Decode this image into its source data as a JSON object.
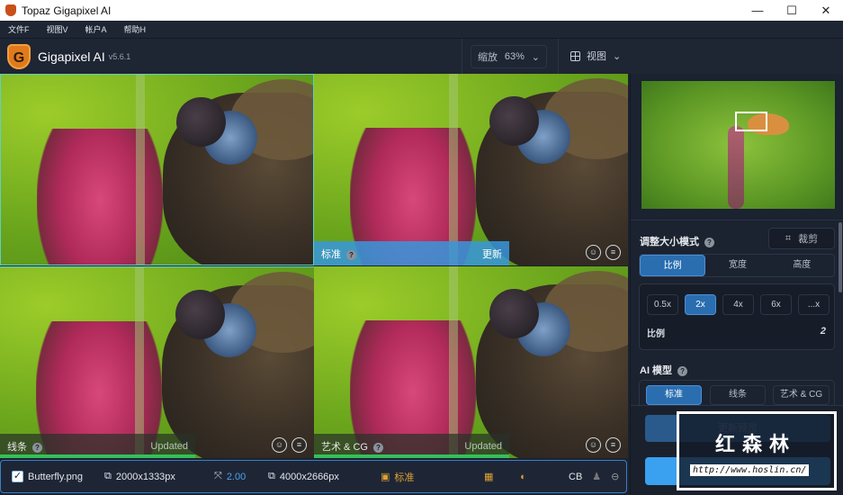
{
  "window": {
    "title": "Topaz Gigapixel AI",
    "min": "—",
    "max": "☐",
    "close": "✕"
  },
  "menu": [
    {
      "label": "文件F"
    },
    {
      "label": "视图V"
    },
    {
      "label": "帐户A"
    },
    {
      "label": "帮助H"
    }
  ],
  "header": {
    "app_name": "Gigapixel AI",
    "version": "v5.6.1",
    "zoom_label": "缩放",
    "zoom_value": "63%",
    "view_label": "视图",
    "logo_letter": "G"
  },
  "panes": [
    {
      "label": "",
      "status": ""
    },
    {
      "label": "标准",
      "status": "更新"
    },
    {
      "label": "线条",
      "status": "Updated"
    },
    {
      "label": "艺术 & CG",
      "status": "Updated"
    }
  ],
  "statusbar": {
    "filename": "Butterfly.png",
    "input_size": "2000x1333px",
    "scale": "2.00",
    "output_size": "4000x2666px",
    "model": "标准",
    "cb": "CB"
  },
  "side": {
    "resize_mode_label": "调整大小模式",
    "crop_label": "裁剪",
    "tabs": [
      "比例",
      "宽度",
      "高度"
    ],
    "scale_options": [
      "0.5x",
      "2x",
      "4x",
      "6x",
      "...x"
    ],
    "scale_label": "比例",
    "scale_value": "2",
    "ai_model_label": "AI 模型",
    "models": [
      "标准",
      "线条",
      "艺术 & CG"
    ],
    "update_preview": "更新预览"
  },
  "watermark": {
    "title": "红森林",
    "url": "http://www.hoslin.cn/"
  },
  "colors": {
    "accent": "#2a6eb0",
    "save": "#3aa0f0",
    "bg": "#1b2230"
  }
}
